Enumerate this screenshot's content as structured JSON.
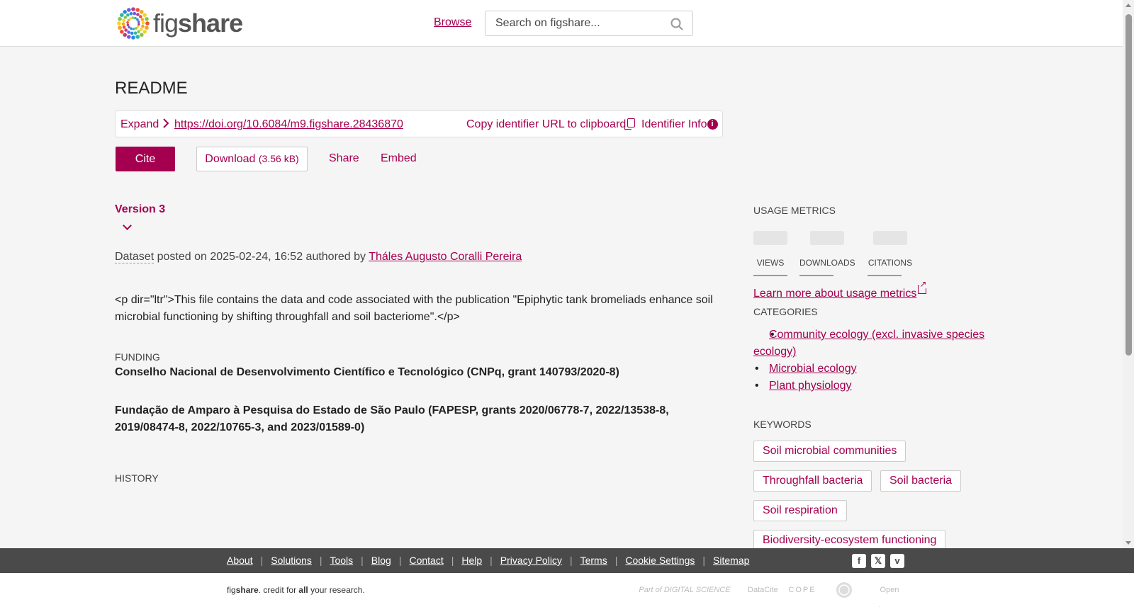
{
  "header": {
    "logo_text_light": "fig",
    "logo_text_bold": "share",
    "browse_label": "Browse",
    "search_placeholder": "Search on figshare..."
  },
  "item": {
    "title": "README",
    "expand_label": "Expand",
    "doi": "https://doi.org/10.6084/m9.figshare.28436870",
    "copy_label": "Copy identifier URL to clipboard",
    "info_label": "Identifier Info",
    "actions": {
      "cite": "Cite",
      "download": "Download",
      "download_size": "(3.56 kB)",
      "share": "Share",
      "embed": "Embed"
    },
    "version": "Version 3",
    "type": "Dataset",
    "posted_text": "posted on 2025-02-24, 16:52 authored by",
    "author": "Tháles Augusto Coralli Pereira",
    "description": "<p dir=\"ltr\">This file contains the data and code associated with the publication \"Epiphytic tank bromeliads enhance soil microbial functioning by shifting throughfall and soil bacteriome\".</p>",
    "funding_label": "FUNDING",
    "funding": [
      "Conselho Nacional de Desenvolvimento Científico e Tecnológico (CNPq, grant 140793/2020-8)",
      "Fundação de Amparo à Pesquisa do Estado de São Paulo (FAPESP, grants 2020/06778-7, 2022/13538-8, 2019/08474-8, 2022/10765-3, and 2023/01589-0)"
    ],
    "history_label": "HISTORY"
  },
  "sidebar": {
    "usage_label": "USAGE METRICS",
    "metrics": [
      "VIEWS",
      "DOWNLOADS",
      "CITATIONS"
    ],
    "learn_more": "Learn more about usage metrics",
    "categories_label": "CATEGORIES",
    "categories": [
      "Community ecology (excl. invasive species ecology)",
      "Microbial ecology",
      "Plant physiology"
    ],
    "keywords_label": "KEYWORDS",
    "keywords": [
      "Soil microbial communities",
      "Throughfall bacteria",
      "Soil bacteria",
      "Soil respiration",
      "Biodiversity-ecosystem functioning"
    ]
  },
  "footer": {
    "links": [
      "About",
      "Solutions",
      "Tools",
      "Blog",
      "Contact",
      "Help",
      "Privacy Policy",
      "Terms",
      "Cookie Settings",
      "Sitemap"
    ],
    "social": [
      "facebook-icon",
      "x-icon",
      "vimeo-icon"
    ],
    "credit_fig": "fig",
    "credit_share": "share",
    "credit_mid": ". credit for ",
    "credit_all": "all",
    "credit_end": " your research.",
    "partners": [
      "Part of DIGITAL SCIENCE",
      "DataCite",
      "COPE",
      "seal",
      "Open Access"
    ]
  },
  "colors": {
    "accent": "#a5004f",
    "footer_bg": "#4a4a4a",
    "page_bg": "#f5f5f5"
  }
}
